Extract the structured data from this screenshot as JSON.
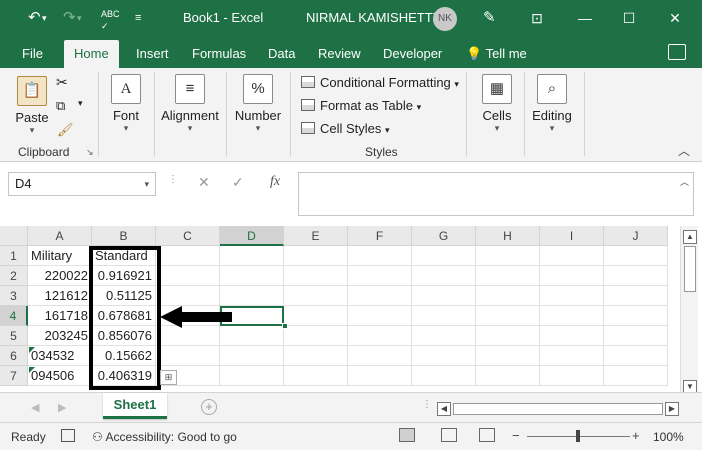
{
  "titlebar": {
    "title": "Book1  -  Excel",
    "user": "NIRMAL KAMISHETTY",
    "avatar_initials": "NK",
    "icons": [
      "save-icon",
      "undo-icon",
      "redo-icon",
      "spelling-icon",
      "customize-icon",
      "pen-icon",
      "ribbon-display-icon",
      "minimize-icon",
      "maximize-icon",
      "close-icon"
    ]
  },
  "tabs": [
    "File",
    "Home",
    "Insert",
    "Formulas",
    "Data",
    "Review",
    "Developer"
  ],
  "active_tab": "Home",
  "tellme": "Tell me",
  "ribbon": {
    "clipboard": {
      "paste": "Paste",
      "group_label": "Clipboard"
    },
    "font": {
      "label": "Font"
    },
    "alignment": {
      "label": "Alignment"
    },
    "number": {
      "label": "Number"
    },
    "styles": {
      "conditional": "Conditional Formatting",
      "format_table": "Format as Table",
      "cell_styles": "Cell Styles",
      "group_label": "Styles"
    },
    "cells": {
      "label": "Cells"
    },
    "editing": {
      "label": "Editing"
    }
  },
  "formula_bar": {
    "name_box": "D4",
    "fx": "fx",
    "content": ""
  },
  "grid": {
    "columns": [
      "A",
      "B",
      "C",
      "D",
      "E",
      "F",
      "G",
      "H",
      "I",
      "J"
    ],
    "rows": [
      "1",
      "2",
      "3",
      "4",
      "5",
      "6",
      "7"
    ],
    "selected_cell": "D4",
    "data": [
      [
        "Military",
        "Standard"
      ],
      [
        "220022",
        "0.916921"
      ],
      [
        "121612",
        "0.51125"
      ],
      [
        "161718",
        "0.678681"
      ],
      [
        "203245",
        "0.856076"
      ],
      [
        "034532",
        "0.15662"
      ],
      [
        "094506",
        "0.406319"
      ]
    ]
  },
  "sheets": [
    "Sheet1"
  ],
  "status": {
    "ready": "Ready",
    "accessibility": "Accessibility: Good to go",
    "zoom": "100%",
    "zoom_out": "−",
    "zoom_in": "+"
  },
  "colors": {
    "excel_green": "#1e7145",
    "ribbon_bg": "#f3f3f3",
    "header_bg": "#e9e9e9"
  }
}
